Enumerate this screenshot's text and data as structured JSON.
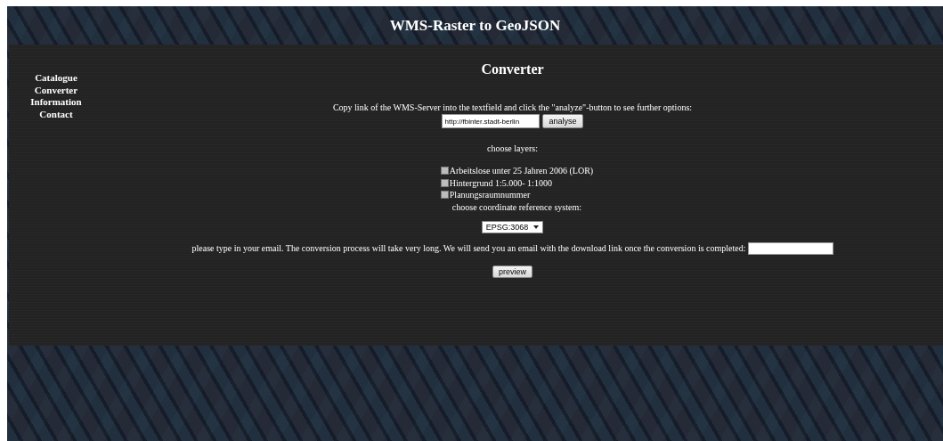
{
  "header": {
    "title": "WMS-Raster to GeoJSON"
  },
  "nav": {
    "items": [
      {
        "label": "Catalogue"
      },
      {
        "label": "Converter"
      },
      {
        "label": "Information"
      },
      {
        "label": "Contact"
      }
    ]
  },
  "main": {
    "heading": "Converter",
    "instructions": "Copy link of the WMS-Server into the textfield and click the \"analyze\"-button to see further options:",
    "url_field": {
      "value": "http://fbinter.stadt-berlin"
    },
    "analyse_button": "analyse",
    "layers_label": "choose layers:",
    "layers": [
      {
        "label": "Arbeitslose unter 25 Jahren 2006 (LOR)",
        "checked": false
      },
      {
        "label": "Hintergrund 1:5.000- 1:1000",
        "checked": false
      },
      {
        "label": "Planungsraumnummer",
        "checked": false
      }
    ],
    "crs_label": "choose coordinate reference system:",
    "crs_select": {
      "value": "EPSG:3068"
    },
    "email_prompt": "please type in your email. The conversion process will take very long. We will send you an email with the download link once the conversion is completed:",
    "preview_button": "preview"
  }
}
